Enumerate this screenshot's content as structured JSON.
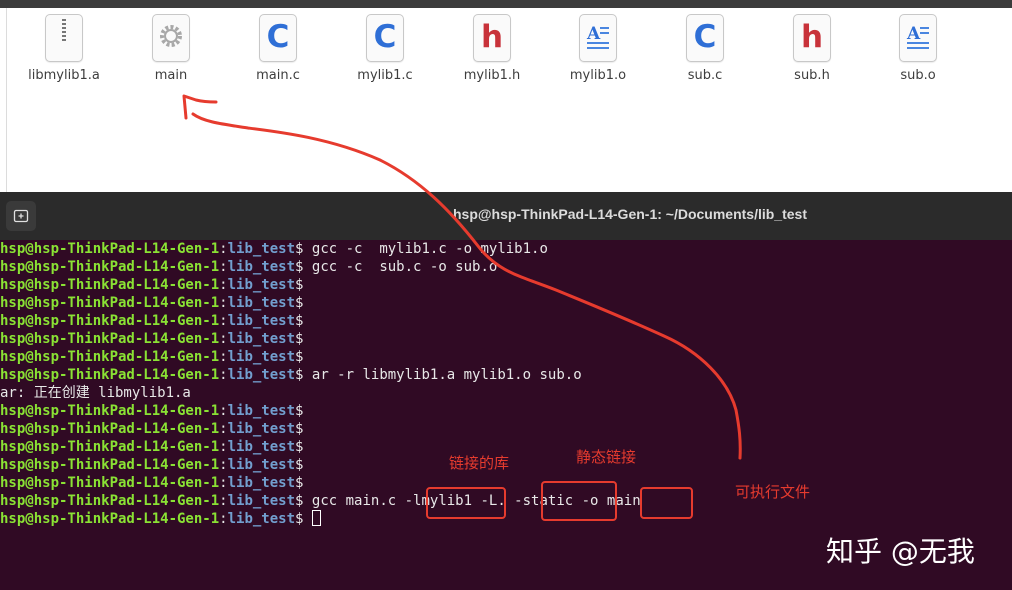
{
  "files": [
    {
      "name": "libmylib1.a",
      "icon": "archive-file-icon"
    },
    {
      "name": "main",
      "icon": "executable-file-icon"
    },
    {
      "name": "main.c",
      "icon": "c-source-file-icon"
    },
    {
      "name": "mylib1.c",
      "icon": "c-source-file-icon"
    },
    {
      "name": "mylib1.h",
      "icon": "c-header-file-icon"
    },
    {
      "name": "mylib1.o",
      "icon": "object-file-icon"
    },
    {
      "name": "sub.c",
      "icon": "c-source-file-icon"
    },
    {
      "name": "sub.h",
      "icon": "c-header-file-icon"
    },
    {
      "name": "sub.o",
      "icon": "object-file-icon"
    }
  ],
  "terminal": {
    "title": "hsp@hsp-ThinkPad-L14-Gen-1: ~/Documents/lib_test",
    "prompt_user": "hsp@hsp-ThinkPad-L14-Gen-1",
    "prompt_sep": ":",
    "prompt_path": "lib_test",
    "prompt_symbol": "$",
    "lines": [
      {
        "type": "prompt",
        "cmd": " gcc -c  mylib1.c -o mylib1.o"
      },
      {
        "type": "prompt",
        "cmd": " gcc -c  sub.c -o sub.o"
      },
      {
        "type": "prompt",
        "cmd": ""
      },
      {
        "type": "prompt",
        "cmd": ""
      },
      {
        "type": "prompt",
        "cmd": ""
      },
      {
        "type": "prompt",
        "cmd": ""
      },
      {
        "type": "prompt",
        "cmd": ""
      },
      {
        "type": "prompt",
        "cmd": " ar -r libmylib1.a mylib1.o sub.o"
      },
      {
        "type": "output",
        "text": "ar: 正在创建 libmylib1.a"
      },
      {
        "type": "prompt",
        "cmd": ""
      },
      {
        "type": "prompt",
        "cmd": ""
      },
      {
        "type": "prompt",
        "cmd": ""
      },
      {
        "type": "prompt",
        "cmd": ""
      },
      {
        "type": "prompt",
        "cmd": ""
      },
      {
        "type": "prompt",
        "cmd": " gcc main.c -lmylib1 -L. -static -o main"
      },
      {
        "type": "prompt",
        "cmd": " ",
        "cursor": true
      }
    ]
  },
  "annotations": {
    "lib_label": "链接的库",
    "static_label": "静态链接",
    "exec_label": "可执行文件",
    "color": "#e63b2e"
  },
  "watermark": "知乎 @无我"
}
